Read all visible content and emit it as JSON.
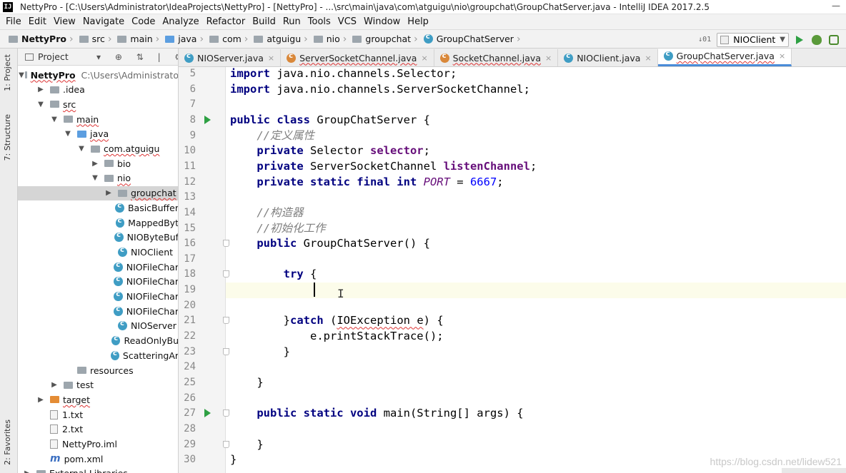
{
  "window": {
    "app_badge": "IJ",
    "title": "NettyPro - [C:\\Users\\Administrator\\IdeaProjects\\NettyPro] - [NettyPro] - ...\\src\\main\\java\\com\\atguigu\\nio\\groupchat\\GroupChatServer.java - IntelliJ IDEA 2017.2.5"
  },
  "menu": [
    "File",
    "Edit",
    "View",
    "Navigate",
    "Code",
    "Analyze",
    "Refactor",
    "Build",
    "Run",
    "Tools",
    "VCS",
    "Window",
    "Help"
  ],
  "breadcrumbs": [
    "NettyPro",
    "src",
    "main",
    "java",
    "com",
    "atguigu",
    "nio",
    "groupchat",
    "GroupChatServer"
  ],
  "run_config": "NIOClient",
  "side_tabs": {
    "project": "1: Project",
    "structure": "7: Structure",
    "favorites": "2: Favorites"
  },
  "project_panel": {
    "title": "Project"
  },
  "tree": [
    {
      "label": "NettyPro",
      "extra": "C:\\Users\\Administrato",
      "arrow": "▼",
      "icon": "folder",
      "depth": 0,
      "bold": true
    },
    {
      "label": ".idea",
      "arrow": "▶",
      "icon": "folder",
      "depth": 1
    },
    {
      "label": "src",
      "arrow": "▼",
      "icon": "folder",
      "depth": 1
    },
    {
      "label": "main",
      "arrow": "▼",
      "icon": "folder",
      "depth": 2
    },
    {
      "label": "java",
      "arrow": "▼",
      "icon": "folder-blue",
      "depth": 3
    },
    {
      "label": "com.atguigu",
      "arrow": "▼",
      "icon": "folder",
      "depth": 4
    },
    {
      "label": "bio",
      "arrow": "▶",
      "icon": "folder",
      "depth": 5
    },
    {
      "label": "nio",
      "arrow": "▼",
      "icon": "folder",
      "depth": 5
    },
    {
      "label": "groupchat",
      "arrow": "▶",
      "icon": "folder",
      "depth": 6,
      "selected": true
    },
    {
      "label": "BasicBuffer",
      "icon": "class",
      "depth": 6
    },
    {
      "label": "MappedByt",
      "icon": "class",
      "depth": 6
    },
    {
      "label": "NIOByteBuf",
      "icon": "class",
      "depth": 6
    },
    {
      "label": "NIOClient",
      "icon": "class",
      "depth": 6
    },
    {
      "label": "NIOFileChar",
      "icon": "class",
      "depth": 6
    },
    {
      "label": "NIOFileChar",
      "icon": "class",
      "depth": 6
    },
    {
      "label": "NIOFileChar",
      "icon": "class",
      "depth": 6
    },
    {
      "label": "NIOFileChar",
      "icon": "class",
      "depth": 6
    },
    {
      "label": "NIOServer",
      "icon": "class",
      "depth": 6
    },
    {
      "label": "ReadOnlyBu",
      "icon": "class",
      "depth": 6
    },
    {
      "label": "ScatteringAr",
      "icon": "class",
      "depth": 6
    },
    {
      "label": "resources",
      "icon": "folder",
      "depth": 3
    },
    {
      "label": "test",
      "arrow": "▶",
      "icon": "folder",
      "depth": 2
    },
    {
      "label": "target",
      "arrow": "▶",
      "icon": "folder-orange",
      "depth": 1
    },
    {
      "label": "1.txt",
      "icon": "file",
      "depth": 1
    },
    {
      "label": "2.txt",
      "icon": "file",
      "depth": 1
    },
    {
      "label": "NettyPro.iml",
      "icon": "file",
      "depth": 1
    },
    {
      "label": "pom.xml",
      "icon": "maven",
      "depth": 1
    },
    {
      "label": "External Libraries",
      "arrow": "▶",
      "icon": "folder",
      "depth": 0
    }
  ],
  "tabs": [
    {
      "label": "NIOServer.java",
      "active": false
    },
    {
      "label": "ServerSocketChannel.java",
      "active": false
    },
    {
      "label": "SocketChannel.java",
      "active": false
    },
    {
      "label": "NIOClient.java",
      "active": false
    },
    {
      "label": "GroupChatServer.java",
      "active": true
    }
  ],
  "code_lines": [
    {
      "n": "5",
      "html": "<span class=\"kw\">import</span> java.nio.channels.Selector;"
    },
    {
      "n": "6",
      "html": "<span class=\"kw\">import</span> java.nio.channels.ServerSocketChannel;"
    },
    {
      "n": "7",
      "html": ""
    },
    {
      "n": "8",
      "html": "<span class=\"kw\">public class</span> GroupChatServer {",
      "run": true
    },
    {
      "n": "9",
      "html": "    <span class=\"cm\">//定义属性</span>"
    },
    {
      "n": "10",
      "html": "    <span class=\"kw\">private</span> Selector <span class=\"fld\">selector</span>;"
    },
    {
      "n": "11",
      "html": "    <span class=\"kw\">private</span> ServerSocketChannel <span class=\"fld\">listenChannel</span>;"
    },
    {
      "n": "12",
      "html": "    <span class=\"kw\">private static final int</span> <span class=\"cst\">PORT</span> = <span class=\"num\">6667</span>;"
    },
    {
      "n": "13",
      "html": ""
    },
    {
      "n": "14",
      "html": "    <span class=\"cm\">//构造器</span>"
    },
    {
      "n": "15",
      "html": "    <span class=\"cm\">//初始化工作</span>"
    },
    {
      "n": "16",
      "html": "    <span class=\"kw\">public</span> GroupChatServer() {",
      "fold": true
    },
    {
      "n": "17",
      "html": ""
    },
    {
      "n": "18",
      "html": "        <span class=\"kw\">try</span> {",
      "fold": true
    },
    {
      "n": "19",
      "html": ""
    },
    {
      "n": "20",
      "html": ""
    },
    {
      "n": "21",
      "html": "        }<span class=\"kw\">catch</span> (<span class=\"err\">IOException e</span>) {",
      "fold": true
    },
    {
      "n": "22",
      "html": "            e.printStackTrace();"
    },
    {
      "n": "23",
      "html": "        }",
      "fold": true
    },
    {
      "n": "24",
      "html": ""
    },
    {
      "n": "25",
      "html": "    }"
    },
    {
      "n": "26",
      "html": ""
    },
    {
      "n": "27",
      "html": "    <span class=\"kw\">public static void</span> main(String[] args) {",
      "run": true,
      "fold": true
    },
    {
      "n": "28",
      "html": ""
    },
    {
      "n": "29",
      "html": "    }",
      "fold": true
    },
    {
      "n": "30",
      "html": "}"
    }
  ],
  "watermark": "https://blog.csdn.net/lidew521"
}
